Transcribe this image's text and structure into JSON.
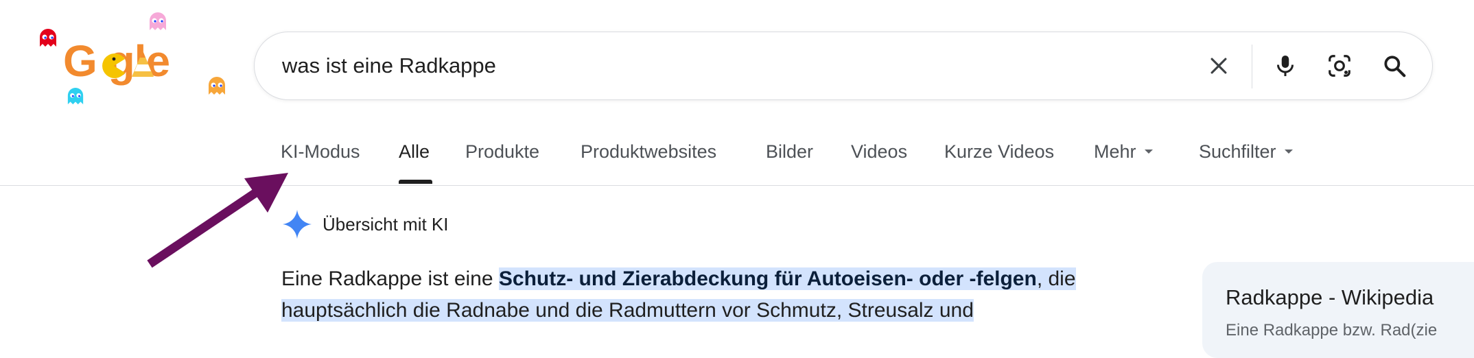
{
  "logo": {
    "text": "G  gle"
  },
  "search": {
    "query": "was ist eine Radkappe",
    "icons": [
      "close-icon",
      "mic-icon",
      "lens-icon",
      "search-icon"
    ]
  },
  "tabs": [
    {
      "label": "KI-Modus"
    },
    {
      "label": "Alle"
    },
    {
      "label": "Produkte"
    },
    {
      "label": "Produktwebsites"
    },
    {
      "label": "Bilder"
    },
    {
      "label": "Videos"
    },
    {
      "label": "Kurze Videos"
    },
    {
      "label": "Mehr"
    },
    {
      "label": "Suchfilter"
    }
  ],
  "active_tab": "Alle",
  "ai_overview": {
    "title": "Übersicht mit KI",
    "intro": "Eine Radkappe ist eine ",
    "highlight_bold": "Schutz- und Zierabdeckung für Autoeisen- oder -felgen",
    "highlight_rest": ", die hauptsächlich die Radnabe und die Radmuttern vor Schmutz, Streusalz und"
  },
  "side_card": {
    "title": "Radkappe - Wikipedia",
    "snippet": "Eine Radkappe bzw. Rad(zie"
  },
  "colors": {
    "accent_blue": "#4285f4",
    "highlight": "#d3e3fd",
    "arrow": "#6a0f5e",
    "logo_orange": "#f28a2e"
  }
}
